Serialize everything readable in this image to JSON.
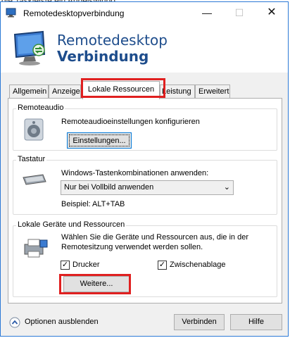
{
  "background": {
    "partial_text": "die Taskleiste ein Anbeiswinbo"
  },
  "window": {
    "title": "Remotedesktopverbindung",
    "controls": {
      "minimize": "—",
      "maximize": "☐",
      "close": "✕"
    }
  },
  "header": {
    "line1": "Remotedesktop",
    "line2": "Verbindung"
  },
  "tabs": [
    {
      "label": "Allgemein"
    },
    {
      "label": "Anzeige"
    },
    {
      "label": "Lokale Ressourcen"
    },
    {
      "label": "Leistung"
    },
    {
      "label": "Erweitert"
    }
  ],
  "remoteaudio": {
    "label": "Remoteaudio",
    "description": "Remoteaudioeinstellungen konfigurieren",
    "button": "Einstellungen..."
  },
  "tastatur": {
    "label": "Tastatur",
    "description": "Windows-Tastenkombinationen anwenden:",
    "selected": "Nur bei Vollbild anwenden",
    "example": "Beispiel: ALT+TAB"
  },
  "devices": {
    "label": "Lokale Geräte und Ressourcen",
    "description_line1": "Wählen Sie die Geräte und Ressourcen aus, die in der",
    "description_line2": "Remotesitzung verwendet werden sollen.",
    "printer_label": "Drucker",
    "printer_checked": true,
    "clipboard_label": "Zwischenablage",
    "clipboard_checked": true,
    "more_button": "Weitere..."
  },
  "footer": {
    "options": "Optionen ausblenden",
    "connect": "Verbinden",
    "help": "Hilfe"
  },
  "colors": {
    "accent_blue": "#1e4d8c",
    "highlight_red": "#e02020",
    "window_border": "#2b79d6"
  }
}
